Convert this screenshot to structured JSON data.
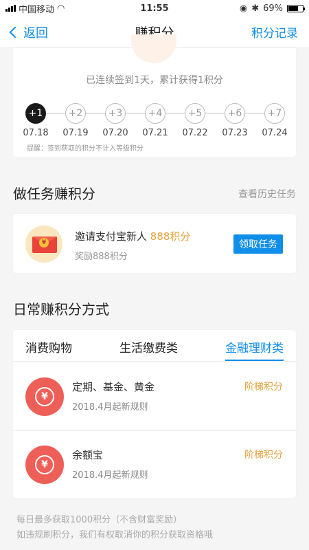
{
  "status_bar": {
    "carrier": "中国移动",
    "time": "11:55",
    "battery": "69%",
    "battery_level": 0.69
  },
  "nav": {
    "back_label": "返回",
    "title": "赚积分",
    "right_label": "积分记录"
  },
  "checkin": {
    "summary": "已连续签到1天，累计获得1积分",
    "days": [
      {
        "label": "+1",
        "date": "07.18",
        "active": true
      },
      {
        "label": "+2",
        "date": "07.19",
        "active": false
      },
      {
        "label": "+3",
        "date": "07.20",
        "active": false
      },
      {
        "label": "+4",
        "date": "07.21",
        "active": false
      },
      {
        "label": "+5",
        "date": "07.22",
        "active": false
      },
      {
        "label": "+6",
        "date": "07.23",
        "active": false
      },
      {
        "label": "+7",
        "date": "07.24",
        "active": false
      }
    ],
    "tip": "提醒：签到获取的积分不计入等级积分"
  },
  "tasks": {
    "title": "做任务赚积分",
    "history_link": "查看历史任务",
    "item": {
      "name": "邀请支付宝新人",
      "points": "888积分",
      "reward": "奖励888积分",
      "button": "领取任务",
      "coin_symbol": "¥"
    }
  },
  "methods": {
    "title": "日常赚积分方式",
    "tabs": [
      {
        "label": "消费购物",
        "active": false
      },
      {
        "label": "生活缴费类",
        "active": false
      },
      {
        "label": "金融理财类",
        "active": true
      }
    ],
    "items": [
      {
        "name": "定期、基金、黄金",
        "rule": "2018.4月起新规则",
        "tag": "阶梯积分",
        "icon_symbol": "¥"
      },
      {
        "name": "余额宝",
        "rule": "2018.4月起新规则",
        "tag": "阶梯积分",
        "icon_symbol": "¥"
      }
    ]
  },
  "footer": {
    "line1": "每日最多获取1000积分（不含财富奖励）",
    "line2": "如违规刷积分，我们有权取消你的积分获取资格哦"
  },
  "colors": {
    "accent": "#108ee9",
    "points": "#e6a23c",
    "method_icon": "#ee5f57"
  }
}
